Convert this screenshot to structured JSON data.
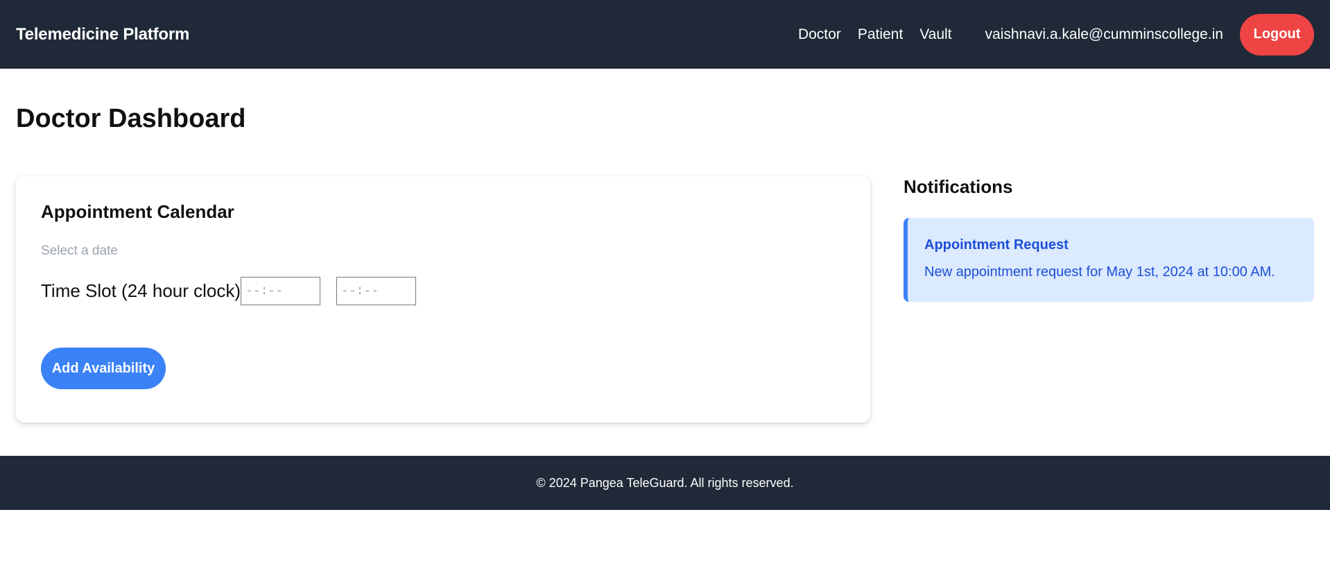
{
  "header": {
    "brand": "Telemedicine Platform",
    "nav": [
      {
        "label": "Doctor"
      },
      {
        "label": "Patient"
      },
      {
        "label": "Vault"
      }
    ],
    "user_email": "vaishnavi.a.kale@cumminscollege.in",
    "logout_label": "Logout"
  },
  "main": {
    "page_title": "Doctor Dashboard",
    "calendar": {
      "title": "Appointment Calendar",
      "date_placeholder": "Select a date",
      "time_slot_label": "Time Slot (24 hour clock)",
      "start_time_placeholder": "--:--",
      "end_time_placeholder": "--:--",
      "add_button_label": "Add Availability"
    },
    "notifications": {
      "title": "Notifications",
      "items": [
        {
          "title": "Appointment Request",
          "body": "New appointment request for May 1st, 2024 at 10:00 AM."
        }
      ]
    }
  },
  "footer": {
    "text": "© 2024 Pangea TeleGuard. All rights reserved."
  },
  "colors": {
    "nav_bg": "#1f2937",
    "logout": "#ef4444",
    "primary": "#3b82f6",
    "notification_bg": "#dbeafe",
    "notification_text": "#1d4ed8"
  }
}
